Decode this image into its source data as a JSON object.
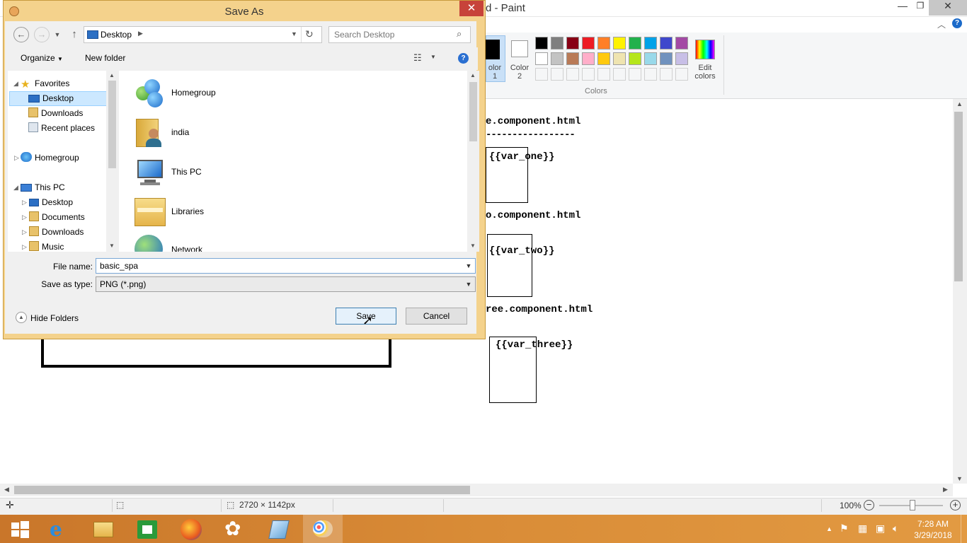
{
  "paint": {
    "title": "d - Paint",
    "color1_label": "olor\n1",
    "color2_label": "Color\n2",
    "edit_colors_label": "Edit\ncolors",
    "colors_group_label": "Colors",
    "palette": [
      "#000000",
      "#7f7f7f",
      "#880015",
      "#ed1c24",
      "#ff7f27",
      "#fff200",
      "#22b14c",
      "#00a2e8",
      "#3f48cc",
      "#a349a4",
      "#ffffff",
      "#c3c3c3",
      "#b97a57",
      "#ffaec9",
      "#ffc90e",
      "#efe4b0",
      "#b5e61d",
      "#99d9ea",
      "#7092be",
      "#c8bfe7"
    ],
    "canvas_text": {
      "l1": "e.component.html",
      "l2": "-----------------",
      "var_one": "{{var_one}}",
      "l3": "o.component.html",
      "var_two": "{{var_two}}",
      "l4": "ree.component.html",
      "var_three": "{{var_three}}"
    },
    "status": {
      "size": "2720 × 1142px",
      "zoom": "100%"
    }
  },
  "dialog": {
    "title": "Save As",
    "address": "Desktop",
    "search_placeholder": "Search Desktop",
    "organize": "Organize",
    "new_folder": "New folder",
    "nav": {
      "favorites": "Favorites",
      "desktop": "Desktop",
      "downloads": "Downloads",
      "recent": "Recent places",
      "homegroup": "Homegroup",
      "this_pc": "This PC",
      "pc_desktop": "Desktop",
      "pc_documents": "Documents",
      "pc_downloads": "Downloads",
      "pc_music": "Music"
    },
    "files": [
      "Homegroup",
      "india",
      "This PC",
      "Libraries",
      "Network"
    ],
    "file_name_label": "File name:",
    "file_name_value": "basic_spa",
    "save_type_label": "Save as type:",
    "save_type_value": "PNG (*.png)",
    "hide_folders": "Hide Folders",
    "save_btn": "Save",
    "cancel_btn": "Cancel"
  },
  "taskbar": {
    "time": "7:28 AM",
    "date": "3/29/2018"
  }
}
